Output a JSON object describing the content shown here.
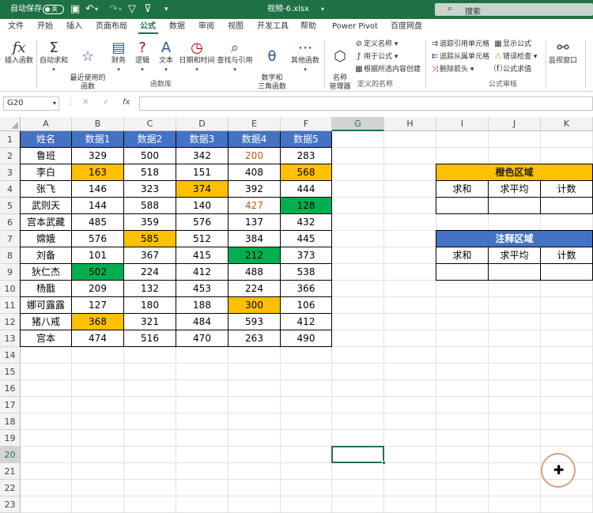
{
  "titlebar": {
    "autosave": "自动保存",
    "toggle": "关",
    "filename": "视频-6.xlsx",
    "search": "搜索"
  },
  "tabs": [
    "文件",
    "开始",
    "插入",
    "页面布局",
    "公式",
    "数据",
    "审阅",
    "视图",
    "开发工具",
    "帮助",
    "Power Pivot",
    "百度网盘"
  ],
  "ribbon": {
    "insert_fn": "插入函数",
    "autosum": "自动求和",
    "recent": "最近使用的\n函数",
    "finance": "财务",
    "logic": "逻辑",
    "text": "文本",
    "datetime": "日期和时间",
    "lookup": "查找与引用",
    "math": "数学和\n三角函数",
    "other": "其他函数",
    "group_lib": "函数库",
    "name_mgr": "名称\n管理器",
    "define_name": "定义名称",
    "use_in_formula": "用于公式",
    "create_from_sel": "根据所选内容创建",
    "group_names": "定义的名称",
    "trace_prec": "追踪引用单元格",
    "trace_dep": "追踪从属单元格",
    "remove_arrows": "删除箭头",
    "show_formulas": "显示公式",
    "error_check": "错误检查",
    "eval_formula": "公式求值",
    "group_audit": "公式审核",
    "watch": "监视窗口"
  },
  "namebox": "G20",
  "columns": [
    "A",
    "B",
    "C",
    "D",
    "E",
    "F",
    "G",
    "H",
    "I",
    "J",
    "K"
  ],
  "rows": [
    "1",
    "2",
    "3",
    "4",
    "5",
    "6",
    "7",
    "8",
    "9",
    "10",
    "11",
    "12",
    "13",
    "14",
    "15",
    "16",
    "17",
    "18",
    "19",
    "20",
    "21",
    "22",
    "23"
  ],
  "table": {
    "headers": [
      "姓名",
      "数据1",
      "数据2",
      "数据3",
      "数据4",
      "数据5"
    ],
    "rows": [
      [
        "鲁班",
        "329",
        "500",
        "342",
        "200",
        "283"
      ],
      [
        "李白",
        "163",
        "518",
        "151",
        "408",
        "568"
      ],
      [
        "张飞",
        "146",
        "323",
        "374",
        "392",
        "444"
      ],
      [
        "武则天",
        "144",
        "588",
        "140",
        "427",
        "128"
      ],
      [
        "宫本武藏",
        "485",
        "359",
        "576",
        "137",
        "432"
      ],
      [
        "嫦娥",
        "576",
        "585",
        "512",
        "384",
        "445"
      ],
      [
        "刘备",
        "101",
        "367",
        "415",
        "212",
        "373"
      ],
      [
        "狄仁杰",
        "502",
        "224",
        "412",
        "488",
        "538"
      ],
      [
        "杨戬",
        "209",
        "132",
        "453",
        "224",
        "366"
      ],
      [
        "娜可露露",
        "127",
        "180",
        "188",
        "300",
        "106"
      ],
      [
        "猪八戒",
        "368",
        "321",
        "484",
        "593",
        "412"
      ],
      [
        "宫本",
        "474",
        "516",
        "470",
        "263",
        "490"
      ]
    ]
  },
  "orange_box": {
    "title": "橙色区域",
    "cols": [
      "求和",
      "求平均",
      "计数"
    ]
  },
  "note_box": {
    "title": "注释区域",
    "cols": [
      "求和",
      "求平均",
      "计数"
    ]
  },
  "colors": {
    "header_blue": "#4472c4",
    "orange": "#ffc000",
    "green": "#00b050",
    "excel_green": "#1e7145"
  }
}
